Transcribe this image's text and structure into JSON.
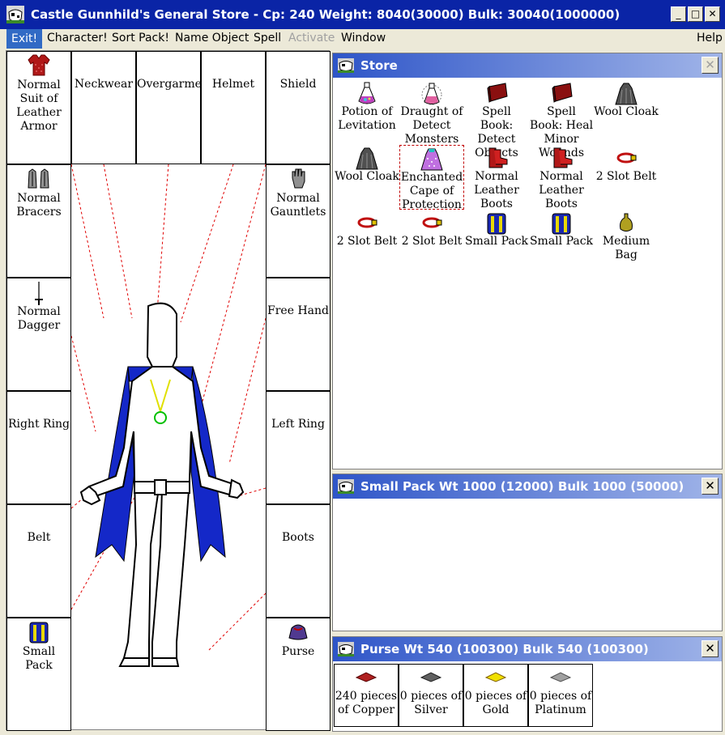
{
  "window": {
    "title": "Castle Gunnhild's General Store - Cp: 240 Weight: 8040(30000) Bulk: 30040(1000000)",
    "minimize": "_",
    "maximize": "□",
    "close": "✕"
  },
  "menu": {
    "exit": "Exit!",
    "character": "Character!",
    "sort_pack": "Sort Pack!",
    "name_object": "Name Object",
    "spell": "Spell",
    "activate": "Activate",
    "window": "Window",
    "help": "Help"
  },
  "equipment": {
    "armor": "Normal Suit of Leather Armor",
    "neckwear": "Neckwear",
    "overgarment": "Overgarment",
    "helmet": "Helmet",
    "shield": "Shield",
    "bracers": "Normal Bracers",
    "gauntlets": "Normal Gauntlets",
    "dagger": "Normal Dagger",
    "free_hand": "Free Hand",
    "right_ring": "Right Ring",
    "left_ring": "Left Ring",
    "belt": "Belt",
    "boots": "Boots",
    "small_pack": "Small Pack",
    "purse": "Purse"
  },
  "store": {
    "title": "Store",
    "close": "✕",
    "items": [
      {
        "label": "Potion of Levitation",
        "icon": "potion-icon"
      },
      {
        "label": "Draught of Detect Monsters",
        "icon": "draught-icon"
      },
      {
        "label": "Spell Book: Detect Objects",
        "icon": "spellbook-icon"
      },
      {
        "label": "Spell Book: Heal Minor Wounds",
        "icon": "spellbook-icon"
      },
      {
        "label": "Wool Cloak",
        "icon": "cloak-icon"
      },
      {
        "label": "Wool Cloak",
        "icon": "cloak-icon"
      },
      {
        "label": "Enchanted Cape of Protection",
        "icon": "cape-icon"
      },
      {
        "label": "Normal Leather Boots",
        "icon": "boots-icon"
      },
      {
        "label": "Normal Leather Boots",
        "icon": "boots-icon"
      },
      {
        "label": "2 Slot Belt",
        "icon": "belt-icon"
      },
      {
        "label": "2 Slot Belt",
        "icon": "belt-icon"
      },
      {
        "label": "2 Slot Belt",
        "icon": "belt-icon"
      },
      {
        "label": "Small Pack",
        "icon": "pack-icon"
      },
      {
        "label": "Small Pack",
        "icon": "pack-icon"
      },
      {
        "label": "Medium Bag",
        "icon": "bag-icon"
      }
    ]
  },
  "small_pack": {
    "title": "Small Pack Wt 1000 (12000) Bulk 1000 (50000)",
    "close": "✕"
  },
  "purse": {
    "title": "Purse Wt 540 (100300) Bulk 540 (100300)",
    "close": "✕",
    "coins": [
      {
        "label": "240 pieces of Copper",
        "color": "#b02020"
      },
      {
        "label": "0 pieces of Silver",
        "color": "#606060"
      },
      {
        "label": "0 pieces of Gold",
        "color": "#f0e000"
      },
      {
        "label": "0 pieces of Platinum",
        "color": "#a0a0a0"
      }
    ]
  },
  "colors": {
    "title_bar": "#0a24a6",
    "panel_title": "#2e55c8",
    "cape": "#1428c8",
    "amulet": "#00c000",
    "chain": "#e0e000",
    "guide_line": "#e00000"
  }
}
